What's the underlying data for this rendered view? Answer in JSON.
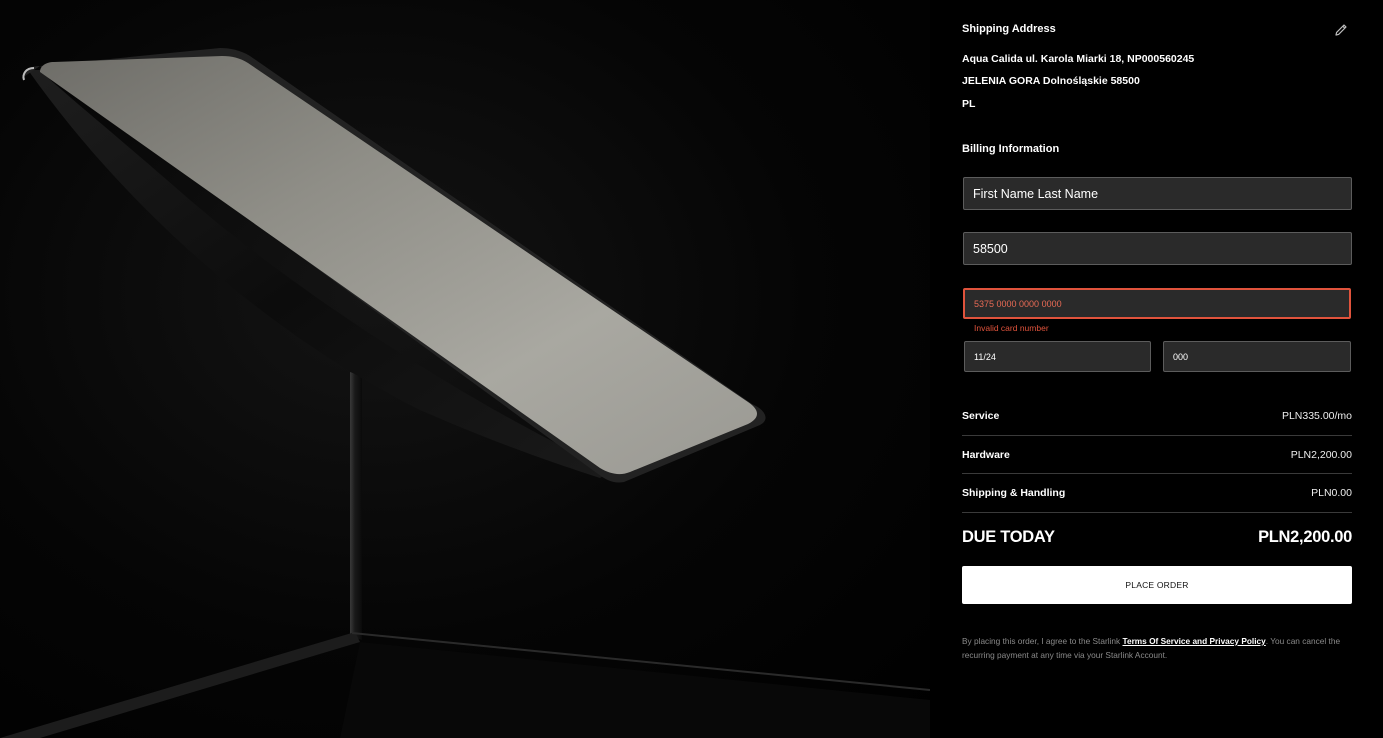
{
  "shipping": {
    "title": "Shipping Address",
    "line1": "Aqua Calida ul. Karola Miarki 18, NP000560245",
    "line2": "JELENIA GORA Dolnośląskie 58500",
    "line3": "PL",
    "edit_icon": "pencil-icon"
  },
  "billing": {
    "title": "Billing Information",
    "name_value": "First Name Last Name",
    "postal_value": "58500",
    "card_value": "5375 0000 0000 0000",
    "card_error": "Invalid card number",
    "expiry_value": "11/24",
    "cvc_value": "000"
  },
  "summary": {
    "service_label": "Service",
    "service_value": "PLN335.00/mo",
    "hardware_label": "Hardware",
    "hardware_value": "PLN2,200.00",
    "shipping_label": "Shipping & Handling",
    "shipping_value": "PLN0.00",
    "due_label": "DUE TODAY",
    "due_value": "PLN2,200.00"
  },
  "place_order_label": "PLACE ORDER",
  "legal": {
    "prefix": "By placing this order, I agree to the Starlink ",
    "link": "Terms Of Service and Privacy Policy",
    "suffix": ". You can cancel the recurring payment at any time via your Starlink Account."
  },
  "colors": {
    "background": "#000000",
    "error": "#e0533c",
    "button": "#ffffff"
  }
}
